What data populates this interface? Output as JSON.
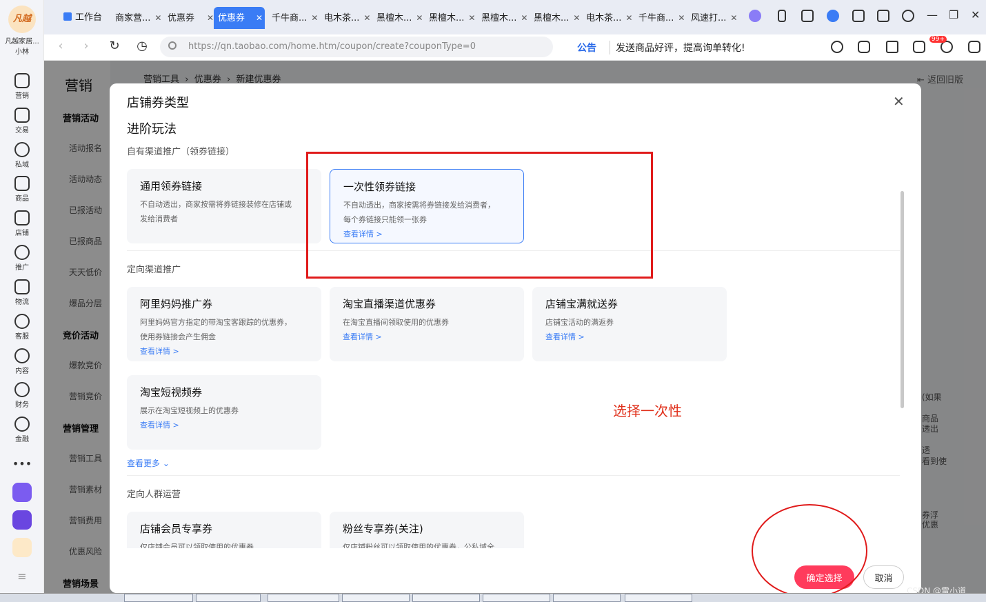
{
  "shop": {
    "name": "凡越家居...",
    "user": "小林"
  },
  "rail_items": [
    "营销",
    "交易",
    "私域",
    "商品",
    "店铺",
    "推广",
    "物流",
    "客服",
    "内容",
    "财务",
    "金融"
  ],
  "tabs": [
    "工作台",
    "商家营...",
    "优惠券",
    "优惠券",
    "千牛商...",
    "电木茶...",
    "黑檀木...",
    "黑檀木...",
    "黑檀木...",
    "黑檀木...",
    "电木茶...",
    "千牛商...",
    "风速打..."
  ],
  "address": {
    "url": "https://qn.taobao.com/home.htm/coupon/create?couponType=0",
    "notice_label": "公告",
    "notice_text": "发送商品好评，提高询单转化!",
    "badge": "99+"
  },
  "page": {
    "side_title": "营销",
    "groups": [
      "营销活动",
      "竞价活动",
      "营销管理",
      "营销场景"
    ],
    "links": [
      "活动报名",
      "活动动态",
      "已报活动",
      "已报商品",
      "天天低价",
      "爆品分层",
      "爆款竞价",
      "营销竞价",
      "营销工具",
      "营销素材",
      "营销费用",
      "优惠风险"
    ],
    "breadcrumb": [
      "营销工具",
      "优惠券",
      "新建优惠券"
    ],
    "old_version": "返回旧版",
    "right_peek": [
      "(如果",
      "商品",
      "透出",
      "透",
      "看到使",
      "券浮",
      "优惠"
    ]
  },
  "modal": {
    "title": "店铺券类型",
    "section": "进阶玩法",
    "groups": [
      {
        "label": "自有渠道推广（领券链接）",
        "cards": [
          {
            "title": "通用领券链接",
            "desc": [
              "不自动透出，商家按需将券链接装修在店铺或",
              "发给消费者"
            ],
            "link": ""
          },
          {
            "title": "一次性领券链接",
            "desc": [
              "不自动透出，商家按需将券链接发给消费者，",
              "每个券链接只能领一张券"
            ],
            "link": "查看详情 >"
          }
        ]
      },
      {
        "label": "定向渠道推广",
        "cards": [
          {
            "title": "阿里妈妈推广券",
            "desc": [
              "阿里妈妈官方指定的带淘宝客跟踪的优惠券，",
              "使用券链接会产生佣金"
            ],
            "link": "查看详情 >"
          },
          {
            "title": "淘宝直播渠道优惠券",
            "desc": [
              "在淘宝直播间领取使用的优惠券"
            ],
            "link": "查看详情 >"
          },
          {
            "title": "店铺宝满就送券",
            "desc": [
              "店铺宝活动的满返券"
            ],
            "link": "查看详情 >"
          },
          {
            "title": "淘宝短视频券",
            "desc": [
              "展示在淘宝短视频上的优惠券"
            ],
            "link": "查看详情 >"
          }
        ]
      },
      {
        "label": "定向人群运营",
        "cards": [
          {
            "title": "店铺会员专享券",
            "desc": [
              "仅店铺会员可以领取使用的优惠券"
            ],
            "link": ""
          },
          {
            "title": "粉丝专享券(关注)",
            "desc": [
              "仅店铺粉丝可以领取使用的优惠券，公私域全"
            ],
            "link": ""
          }
        ]
      }
    ],
    "see_more": "查看更多",
    "confirm": "确定选择",
    "cancel": "取消"
  },
  "annotation": {
    "text": "选择一次性",
    "color": "#e0301b"
  },
  "watermark": "CSDN @雷小道"
}
